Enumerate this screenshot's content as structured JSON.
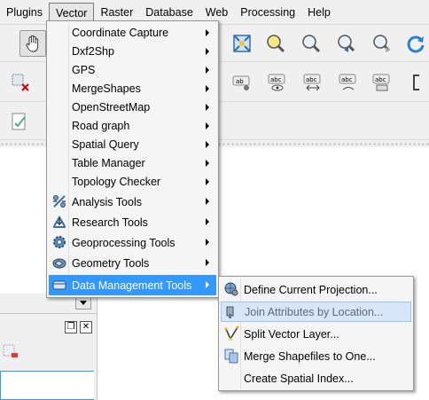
{
  "menubar": {
    "items": [
      "Plugins",
      "Vector",
      "Raster",
      "Database",
      "Web",
      "Processing",
      "Help"
    ]
  },
  "vector_menu": {
    "items": [
      {
        "label": "Coordinate Capture",
        "submenu": true
      },
      {
        "label": "Dxf2Shp",
        "submenu": true
      },
      {
        "label": "GPS",
        "submenu": true
      },
      {
        "label": "MergeShapes",
        "submenu": true
      },
      {
        "label": "OpenStreetMap",
        "submenu": true
      },
      {
        "label": "Road graph",
        "submenu": true
      },
      {
        "label": "Spatial Query",
        "submenu": true
      },
      {
        "label": "Table Manager",
        "submenu": true
      },
      {
        "label": "Topology Checker",
        "submenu": true
      },
      {
        "label": "Analysis Tools",
        "submenu": true
      },
      {
        "label": "Research Tools",
        "submenu": true
      },
      {
        "label": "Geoprocessing Tools",
        "submenu": true
      },
      {
        "label": "Geometry Tools",
        "submenu": true
      },
      {
        "label": "Data Management Tools",
        "submenu": true
      }
    ]
  },
  "data_management_menu": {
    "items": [
      {
        "label": "Define Current Projection..."
      },
      {
        "label": "Join Attributes by Location..."
      },
      {
        "label": "Split Vector Layer..."
      },
      {
        "label": "Merge Shapefiles to One..."
      },
      {
        "label": "Create Spatial Index..."
      }
    ]
  },
  "colors": {
    "highlight": "#3399ff",
    "hover": "#d5e7f8"
  }
}
